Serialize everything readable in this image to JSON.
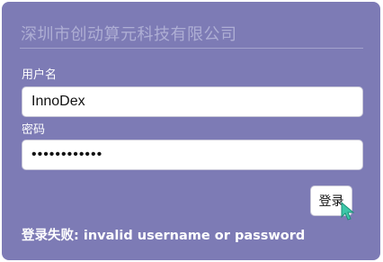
{
  "header": {
    "company_name": "深圳市创动算元科技有限公司"
  },
  "form": {
    "username_label": "用户名",
    "username_value": "InnoDex",
    "password_label": "密码",
    "password_value": "••••••••••••",
    "login_button": "登录",
    "error_message": "登录失败: invalid username or password"
  },
  "colors": {
    "panel_background": "#7d7bb5",
    "cursor": "#3cc8a8"
  },
  "icons": {
    "cursor": "mouse-pointer-icon"
  }
}
